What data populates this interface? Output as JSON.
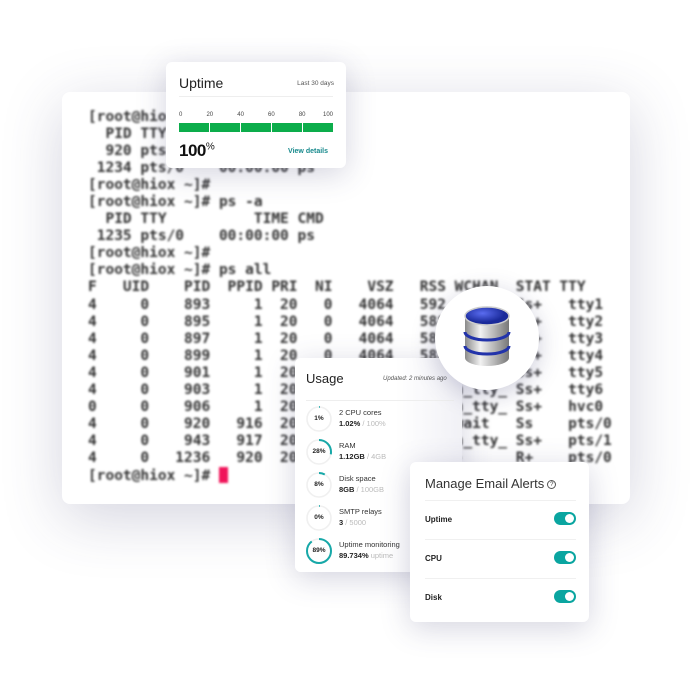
{
  "terminal": {
    "lines": [
      "[root@hiox ~]# ps",
      "  PID TTY          TIME CMD",
      "  920 pts/0    00:00:00 bash",
      " 1234 pts/0    00:00:00 ps",
      "[root@hiox ~]#",
      "[root@hiox ~]# ps -a",
      "  PID TTY          TIME CMD",
      " 1235 pts/0    00:00:00 ps",
      "[root@hiox ~]#",
      "[root@hiox ~]# ps all",
      "F   UID    PID  PPID PRI  NI    VSZ   RSS WCHAN  STAT TTY",
      "4     0    893     1  20   0   4064   592 n_tty_ Ss+   tty1",
      "4     0    895     1  20   0   4064   588 n_tty_ Ss+   tty2",
      "4     0    897     1  20   0   4064   588 n_tty_ Ss+   tty3",
      "4     0    899     1  20   0   4064   588 n_tty_ Ss+   tty4",
      "4     0    901     1  20   0   4064   588 n_tty_ Ss+   tty5",
      "4     0    903     1  20   0   4064   588 n_tty_ Ss+   tty6",
      "0     0    906     1  20   0   4064   588 n_tty_ Ss+   hvc0",
      "4     0    920   916  20   0  11500  2700 wait   Ss    pts/0",
      "4     0    943   917  20   0  11500  2700 n_tty_ Ss+   pts/1",
      "4     0   1236   920  20   0  11500  1100 -      R+    pts/0"
    ],
    "prompt": "[root@hiox ~]# ",
    "cursor_color": "#f0145a"
  },
  "uptime": {
    "title": "Uptime",
    "range": "Last 30 days",
    "ticks": [
      "0",
      "20",
      "40",
      "60",
      "80",
      "100"
    ],
    "value_percent": 100,
    "value": "100",
    "unit": "%",
    "view_details": "View details",
    "bar_color": "#0cad4b"
  },
  "usage": {
    "title": "Usage",
    "updated": "Updated: 2 minutes ago",
    "accent": "#17a8a8",
    "items": [
      {
        "pct": 1,
        "ring_label": "1%",
        "name": "2 CPU cores",
        "value": "1.02%",
        "total": " / 100%"
      },
      {
        "pct": 28,
        "ring_label": "28%",
        "name": "RAM",
        "value": "1.12GB",
        "total": " / 4GB"
      },
      {
        "pct": 8,
        "ring_label": "8%",
        "name": "Disk space",
        "value": "8GB",
        "total": " / 100GB"
      },
      {
        "pct": 0,
        "ring_label": "0%",
        "name": "SMTP relays",
        "value": "3",
        "total": " / 5000"
      },
      {
        "pct": 89,
        "ring_label": "89%",
        "name": "Uptime monitoring",
        "value": "89.734%",
        "total": " uptime"
      }
    ]
  },
  "alerts": {
    "title": "Manage Email Alerts",
    "help_icon": "?",
    "items": [
      {
        "label": "Uptime",
        "enabled": true
      },
      {
        "label": "CPU",
        "enabled": true
      },
      {
        "label": "Disk",
        "enabled": true
      }
    ],
    "toggle_color": "#0aa5a0"
  },
  "badge": {
    "icon": "database-icon"
  }
}
